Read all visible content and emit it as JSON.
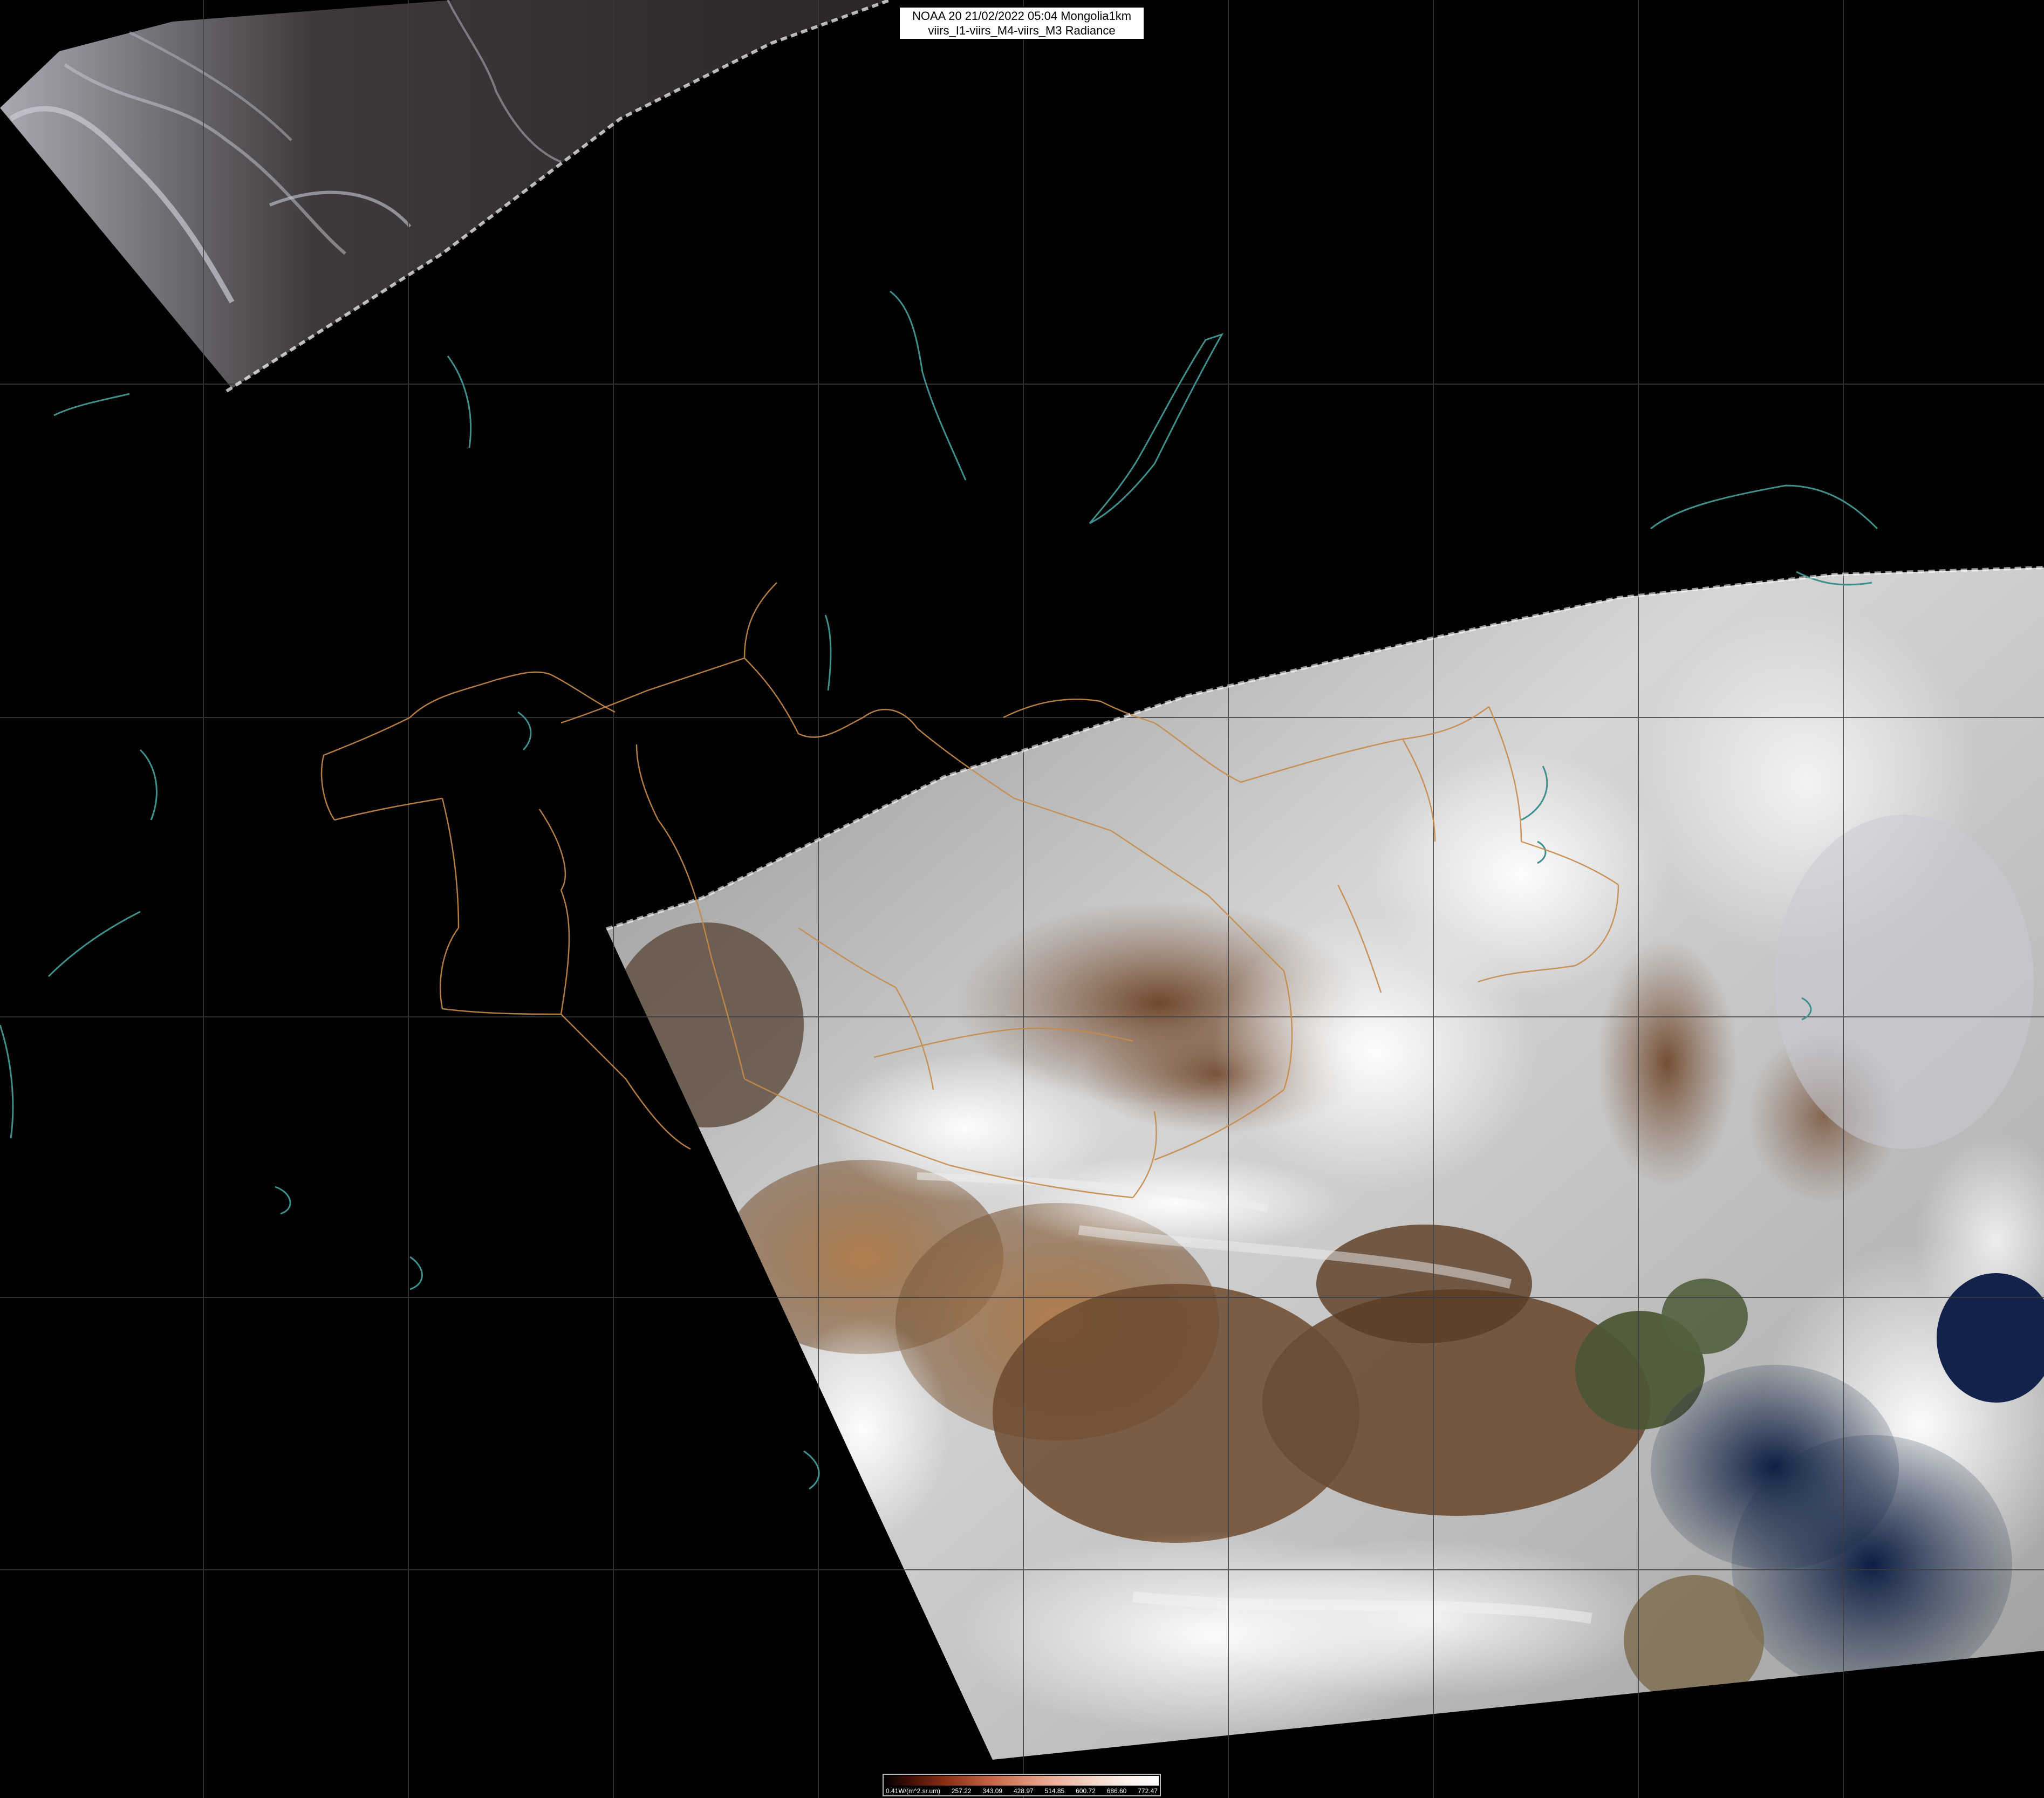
{
  "title": {
    "line1": "NOAA 20 21/02/2022 05:04 Mongolia1km",
    "line2": "viirs_I1-viirs_M4-viirs_M3 Radiance"
  },
  "colorbar": {
    "labels": [
      "0.41W/(m^2.sr.um)",
      "257.22",
      "343.09",
      "428.97",
      "514.85",
      "600.72",
      "686.60",
      "772.47"
    ]
  },
  "colors": {
    "background": "#000000",
    "grid": "#3c3c3c",
    "admin_border": "#c78a4a",
    "water_outline": "#3f8f8c",
    "snow": "#e8e8e8",
    "desert": "#a7784e",
    "dry_land": "#6e4a2e",
    "sea": "#17233f",
    "turbid_water": "#5c6a4a"
  }
}
